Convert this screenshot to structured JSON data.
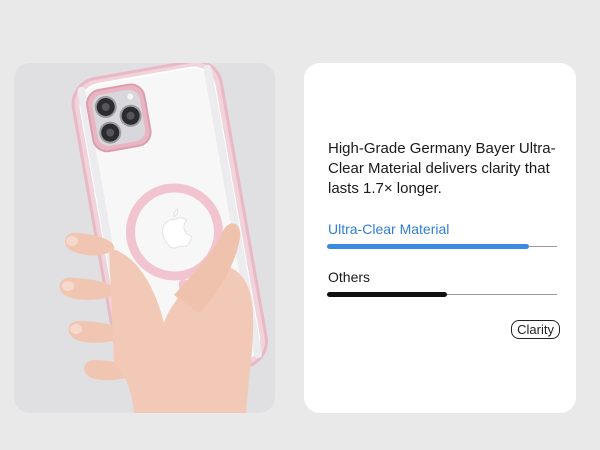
{
  "headline": "High-Grade Germany Bayer Ultra-Clear Material delivers clarity that lasts 1.7× longer.",
  "bars": [
    {
      "label": "Ultra-Clear Material",
      "value": 0.88,
      "color": "#3b8be3"
    },
    {
      "label": "Others",
      "value": 0.52,
      "color": "#111111"
    }
  ],
  "tag": "Clarity",
  "colors": {
    "page_bg": "#e9e9e9",
    "card_bg": "#ffffff",
    "accent_blue": "#3b8be3",
    "case_pink": "#f2c4cf"
  },
  "icons": {
    "magsafe_ring": "magsafe-ring-icon",
    "apple_logo": "apple-logo-icon"
  }
}
